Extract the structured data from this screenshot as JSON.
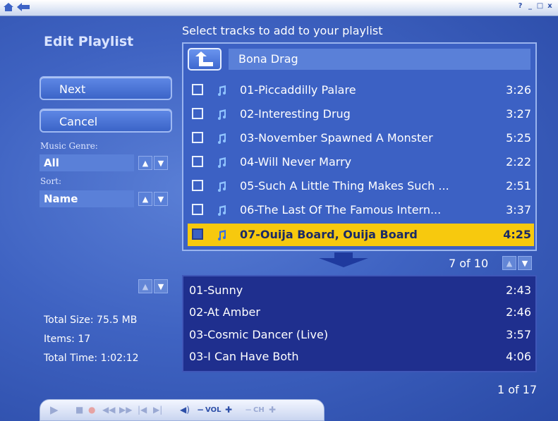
{
  "window": {
    "home_icon": "home-icon",
    "back_icon": "back-arrow-icon",
    "controls": [
      "?",
      "_",
      "□",
      "x"
    ]
  },
  "sidebar": {
    "title": "Edit Playlist",
    "next_label": "Next",
    "cancel_label": "Cancel",
    "genre_label": "Music Genre:",
    "genre_value": "All",
    "sort_label": "Sort:",
    "sort_value": "Name"
  },
  "browser": {
    "heading": "Select tracks to add to your playlist",
    "folder": "Bona Drag",
    "tracks": [
      {
        "name": "01-Piccaddilly Palare",
        "duration": "3:26"
      },
      {
        "name": "02-Interesting Drug",
        "duration": "3:27"
      },
      {
        "name": "03-November Spawned A Monster",
        "duration": "5:25"
      },
      {
        "name": "04-Will Never Marry",
        "duration": "2:22"
      },
      {
        "name": "05-Such A Little Thing Makes Such ...",
        "duration": "2:51"
      },
      {
        "name": "06-The Last Of The Famous Intern...",
        "duration": "3:37"
      },
      {
        "name": "07-Ouija Board, Ouija Board",
        "duration": "4:25"
      }
    ],
    "page": "7 of 10",
    "highlight_color": "#f7c90e"
  },
  "playlist": {
    "items": [
      {
        "name": "01-Sunny",
        "duration": "2:43"
      },
      {
        "name": "02-At Amber",
        "duration": "2:46"
      },
      {
        "name": "03-Cosmic Dancer (Live)",
        "duration": "3:57"
      },
      {
        "name": "03-I Can Have Both",
        "duration": "4:06"
      }
    ],
    "page": "1 of 17"
  },
  "stats": {
    "total_size": "Total Size: 75.5 MB",
    "items": "Items: 17",
    "total_time": "Total Time: 1:02:12"
  },
  "transport": {
    "vol_label": "VOL",
    "ch_label": "CH"
  }
}
